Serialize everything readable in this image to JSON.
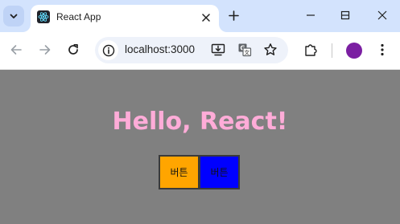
{
  "browser": {
    "tab": {
      "title": "React App"
    },
    "address_bar": {
      "url": "localhost:3000"
    },
    "icons": {
      "tab_search": "chevron-down-icon",
      "favicon": "react-logo-icon",
      "tab_close": "close-icon",
      "new_tab": "plus-icon",
      "minimize": "minimize-icon",
      "maximize": "maximize-icon",
      "close_window": "close-icon",
      "back": "arrow-left-icon",
      "forward": "arrow-right-icon",
      "reload": "reload-icon",
      "site_info": "info-icon",
      "install_app": "install-app-icon",
      "translate": "translate-icon",
      "bookmark": "star-icon",
      "extensions": "puzzle-icon",
      "profile": "avatar",
      "menu": "more-vertical-icon"
    },
    "colors": {
      "tabstrip_bg": "#d3e3fd",
      "toolbar_bg": "#ffffff",
      "omnibox_bg": "#eef2fa",
      "profile_avatar": "#7b1fa2"
    }
  },
  "page": {
    "heading": "Hello, React!",
    "buttons": [
      {
        "label": "버튼",
        "color": "#ffa500"
      },
      {
        "label": "버튼",
        "color": "#0000ff"
      }
    ],
    "colors": {
      "background": "#808080",
      "heading": "#ffacd8"
    }
  }
}
